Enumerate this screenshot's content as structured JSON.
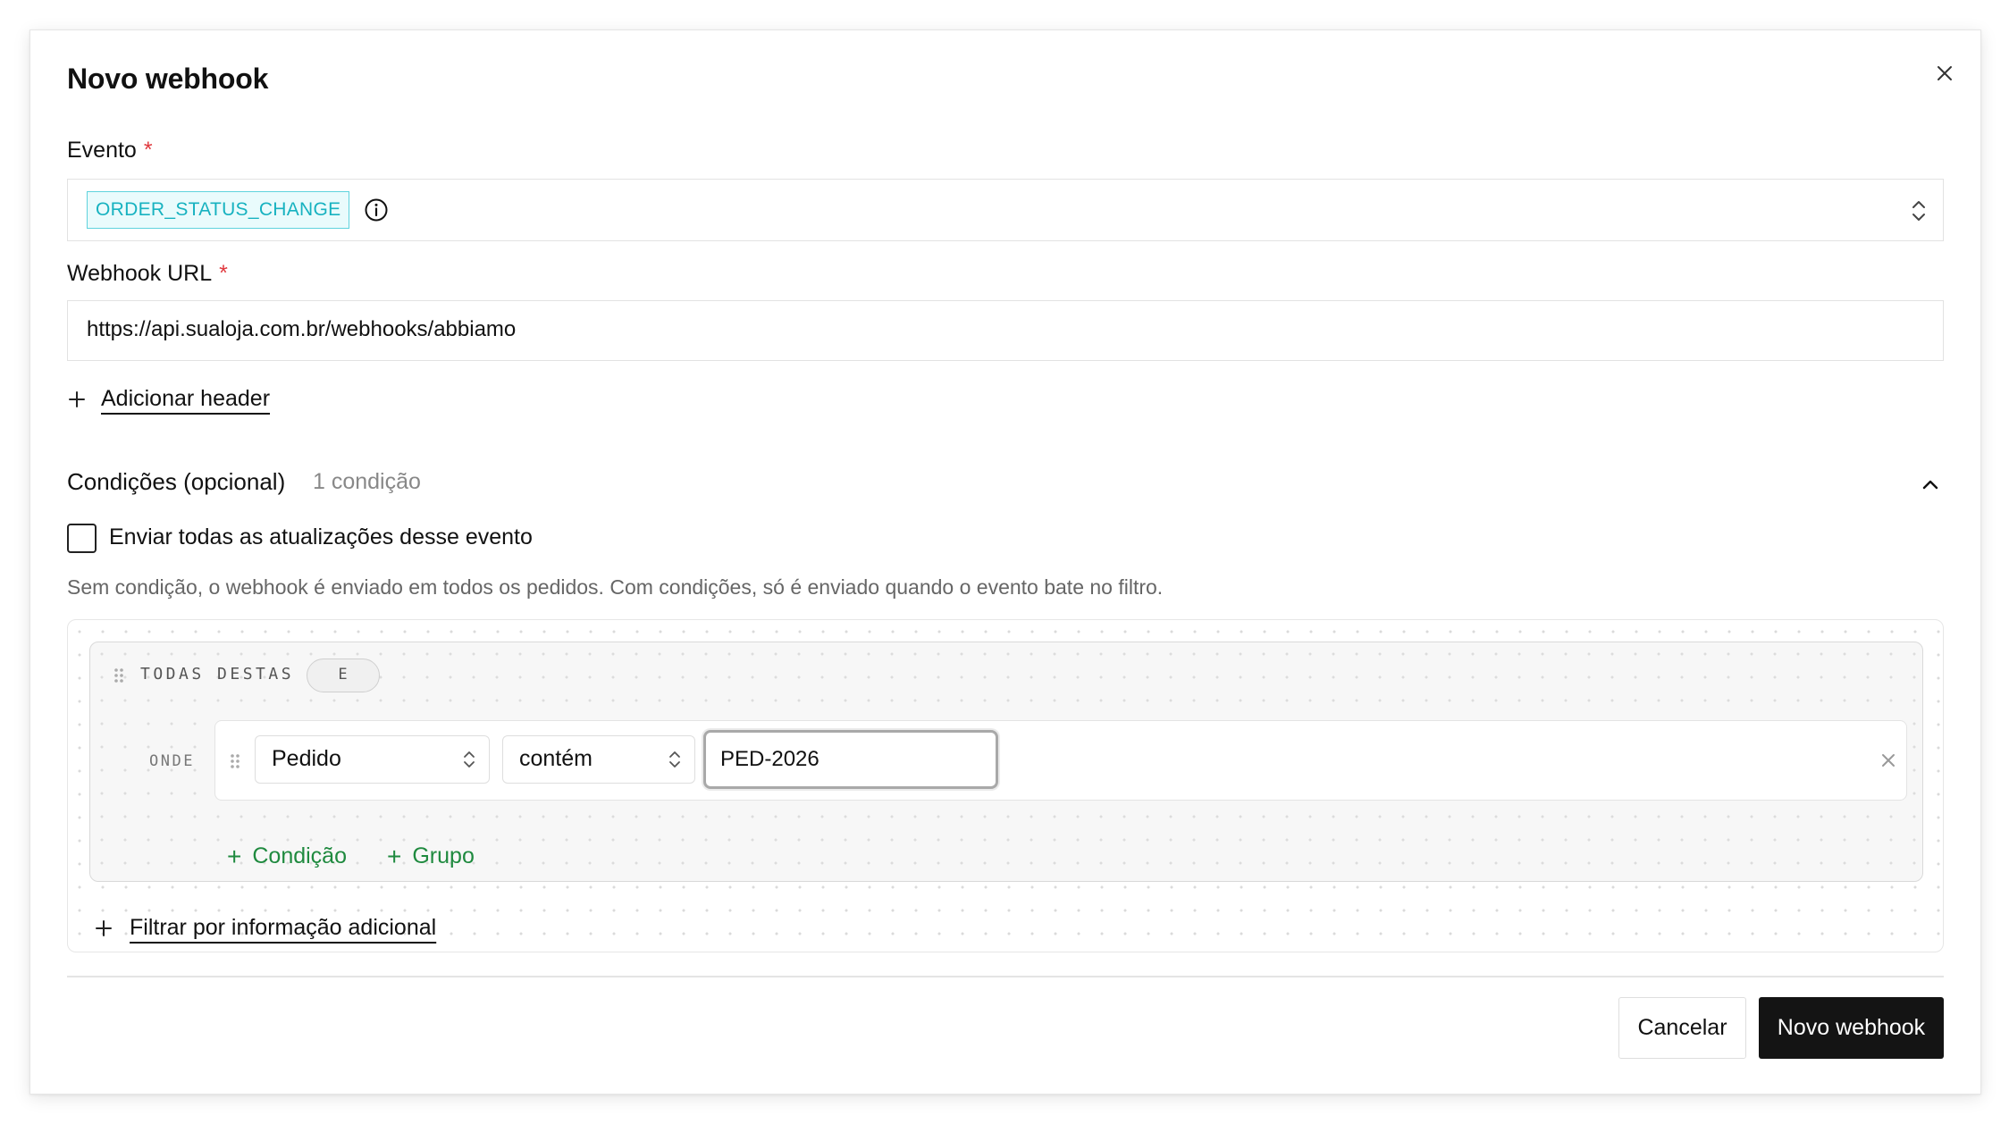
{
  "modal": {
    "title": "Novo webhook"
  },
  "evento": {
    "label": "Evento",
    "required_mark": "*",
    "selected_tag": "ORDER_STATUS_CHANGE"
  },
  "webhook_url": {
    "label": "Webhook URL",
    "required_mark": "*",
    "value": "https://api.sualoja.com.br/webhooks/abbiamo"
  },
  "add_header": {
    "label": "Adicionar header"
  },
  "conditions": {
    "title": "Condições (opcional)",
    "count": "1 condição",
    "send_all_label": "Enviar todas as atualizações desse evento",
    "send_all_checked": false,
    "hint": "Sem condição, o webhook é enviado em todos os pedidos. Com condições, só é enviado quando o evento bate no filtro.",
    "group": {
      "label": "TODAS DESTAS",
      "operator": "E",
      "where_label": "ONDE",
      "rows": [
        {
          "field": "Pedido",
          "operator": "contém",
          "value": "PED-2026"
        }
      ],
      "add_condition_label": "Condição",
      "add_group_label": "Grupo"
    },
    "extra_filter_label": "Filtrar por informação adicional"
  },
  "footer": {
    "cancel_label": "Cancelar",
    "submit_label": "Novo webhook"
  },
  "colors": {
    "tag_text": "#17b2c0",
    "tag_border": "#5fd3dd",
    "required": "#e0393e",
    "link_green": "#1f8a3f",
    "primary_button": "#141414"
  }
}
